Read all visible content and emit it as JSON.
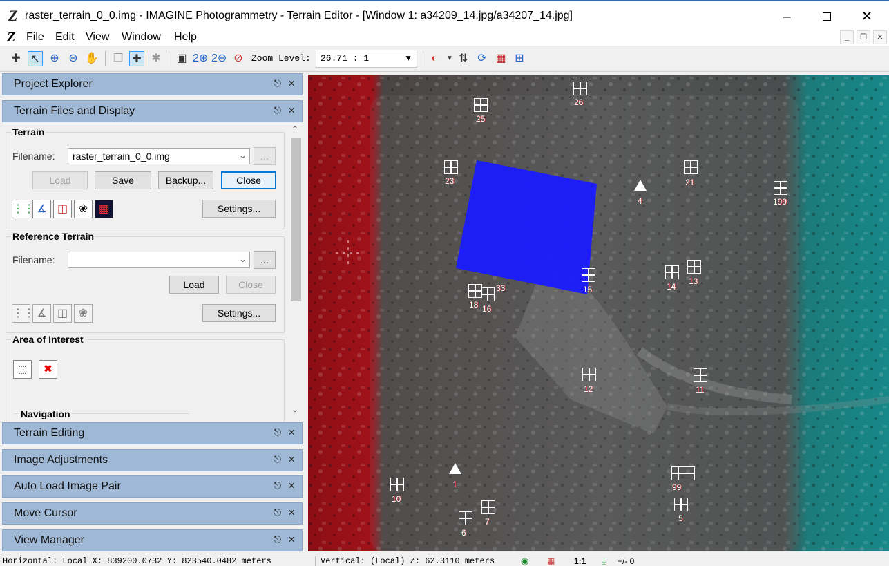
{
  "window": {
    "title": "raster_terrain_0_0.img - IMAGINE Photogrammetry - Terrain Editor - [Window 1: a34209_14.jpg/a34207_14.jpg]",
    "app_icon": "Z"
  },
  "menu": [
    "File",
    "Edit",
    "View",
    "Window",
    "Help"
  ],
  "toolbar": {
    "zoom_label": "Zoom Level:",
    "zoom_value": "26.71 : 1"
  },
  "panels": {
    "project_explorer": "Project Explorer",
    "terrain_files": "Terrain Files and Display",
    "terrain_editing": "Terrain Editing",
    "image_adjustments": "Image Adjustments",
    "auto_load": "Auto Load Image Pair",
    "move_cursor": "Move Cursor",
    "view_manager": "View Manager"
  },
  "terrain": {
    "group_title": "Terrain",
    "filename_label": "Filename:",
    "filename_value": "raster_terrain_0_0.img",
    "browse": "...",
    "load": "Load",
    "save": "Save",
    "backup": "Backup...",
    "close": "Close",
    "settings": "Settings..."
  },
  "reference": {
    "group_title": "Reference Terrain",
    "filename_label": "Filename:",
    "filename_value": "",
    "browse": "...",
    "load": "Load",
    "close": "Close",
    "settings": "Settings..."
  },
  "aoi": {
    "group_title": "Area of Interest"
  },
  "navigation": {
    "group_title": "Navigation"
  },
  "gcps": [
    {
      "label": "26"
    },
    {
      "label": "25"
    },
    {
      "label": "23"
    },
    {
      "label": "21"
    },
    {
      "label": "199"
    },
    {
      "label": "4"
    },
    {
      "label": "15"
    },
    {
      "label": "14"
    },
    {
      "label": "13"
    },
    {
      "label": "33"
    },
    {
      "label": "18"
    },
    {
      "label": "16"
    },
    {
      "label": "12"
    },
    {
      "label": "11"
    },
    {
      "label": "10"
    },
    {
      "label": "1"
    },
    {
      "label": "7"
    },
    {
      "label": "6"
    },
    {
      "label": "99"
    },
    {
      "label": "5"
    }
  ],
  "status": {
    "horizontal": "Horizontal: Local X:  839200.0732  Y:  823540.0482 meters",
    "vertical": "Vertical: (Local) Z: 62.3110 meters",
    "scale": "1:1",
    "tolerance": "+/- 0"
  },
  "colors": {
    "panel_header": "#9eb8d6",
    "overlay_terrain": "#1a1aff",
    "anaglyph_red": "#c0141e",
    "anaglyph_cyan": "#1fa5a5"
  }
}
